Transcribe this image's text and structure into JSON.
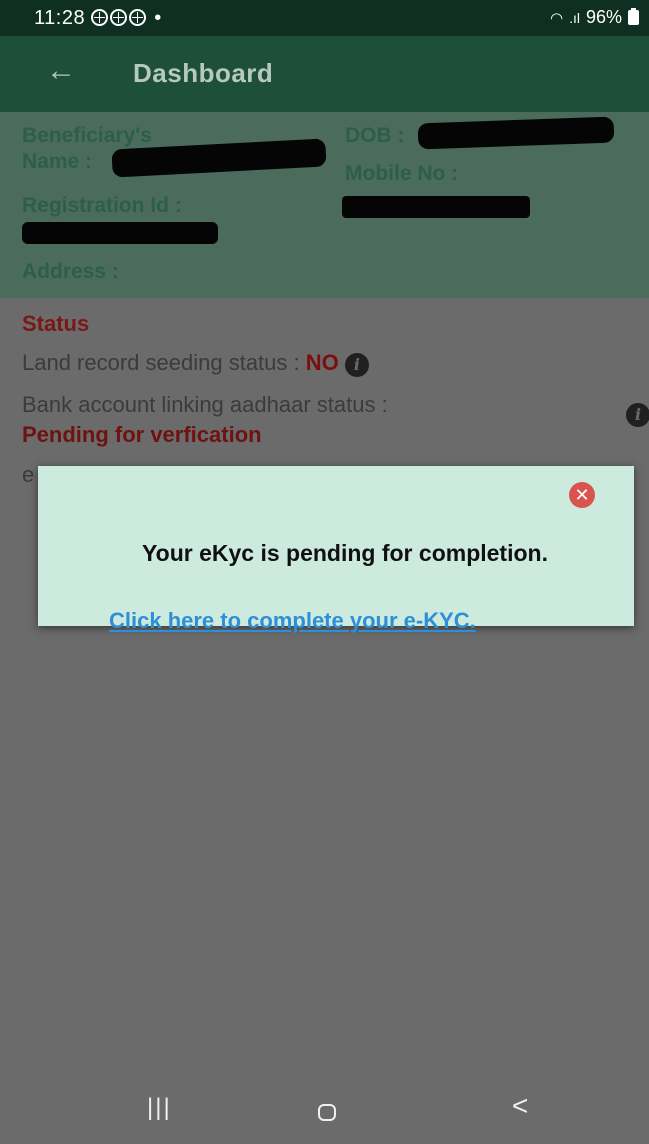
{
  "status_bar": {
    "time": "11:28",
    "battery": "96%"
  },
  "app_bar": {
    "back_symbol": "←",
    "title": "Dashboard"
  },
  "beneficiary": {
    "name_label_line1": "Beneficiary's",
    "name_label_line2": "Name :",
    "dob_label": "DOB :",
    "mobile_label": "Mobile No :",
    "registration_label": "Registration Id :",
    "address_label": "Address :"
  },
  "status_section": {
    "heading": "Status",
    "land_record_label": "Land record seeding status :",
    "land_record_value": "NO",
    "bank_label": "Bank account linking aadhaar status :",
    "bank_value": "Pending for verfication",
    "ekyc_partial": "e",
    "info_glyph": "i"
  },
  "dialog": {
    "close_symbol": "✕",
    "message": "Your eKyc is pending for completion.",
    "link": "Click here to complete your e-KYC."
  },
  "nav_bar": {
    "recent_symbol": "|||",
    "back_symbol": "<"
  },
  "colors": {
    "status_bar": "#0f2f22",
    "app_bar": "#1e4f38",
    "dialog_bg": "#cdeadf",
    "link": "#2f8fd6",
    "status_red": "#7a1818",
    "close_red": "#d9544f"
  }
}
